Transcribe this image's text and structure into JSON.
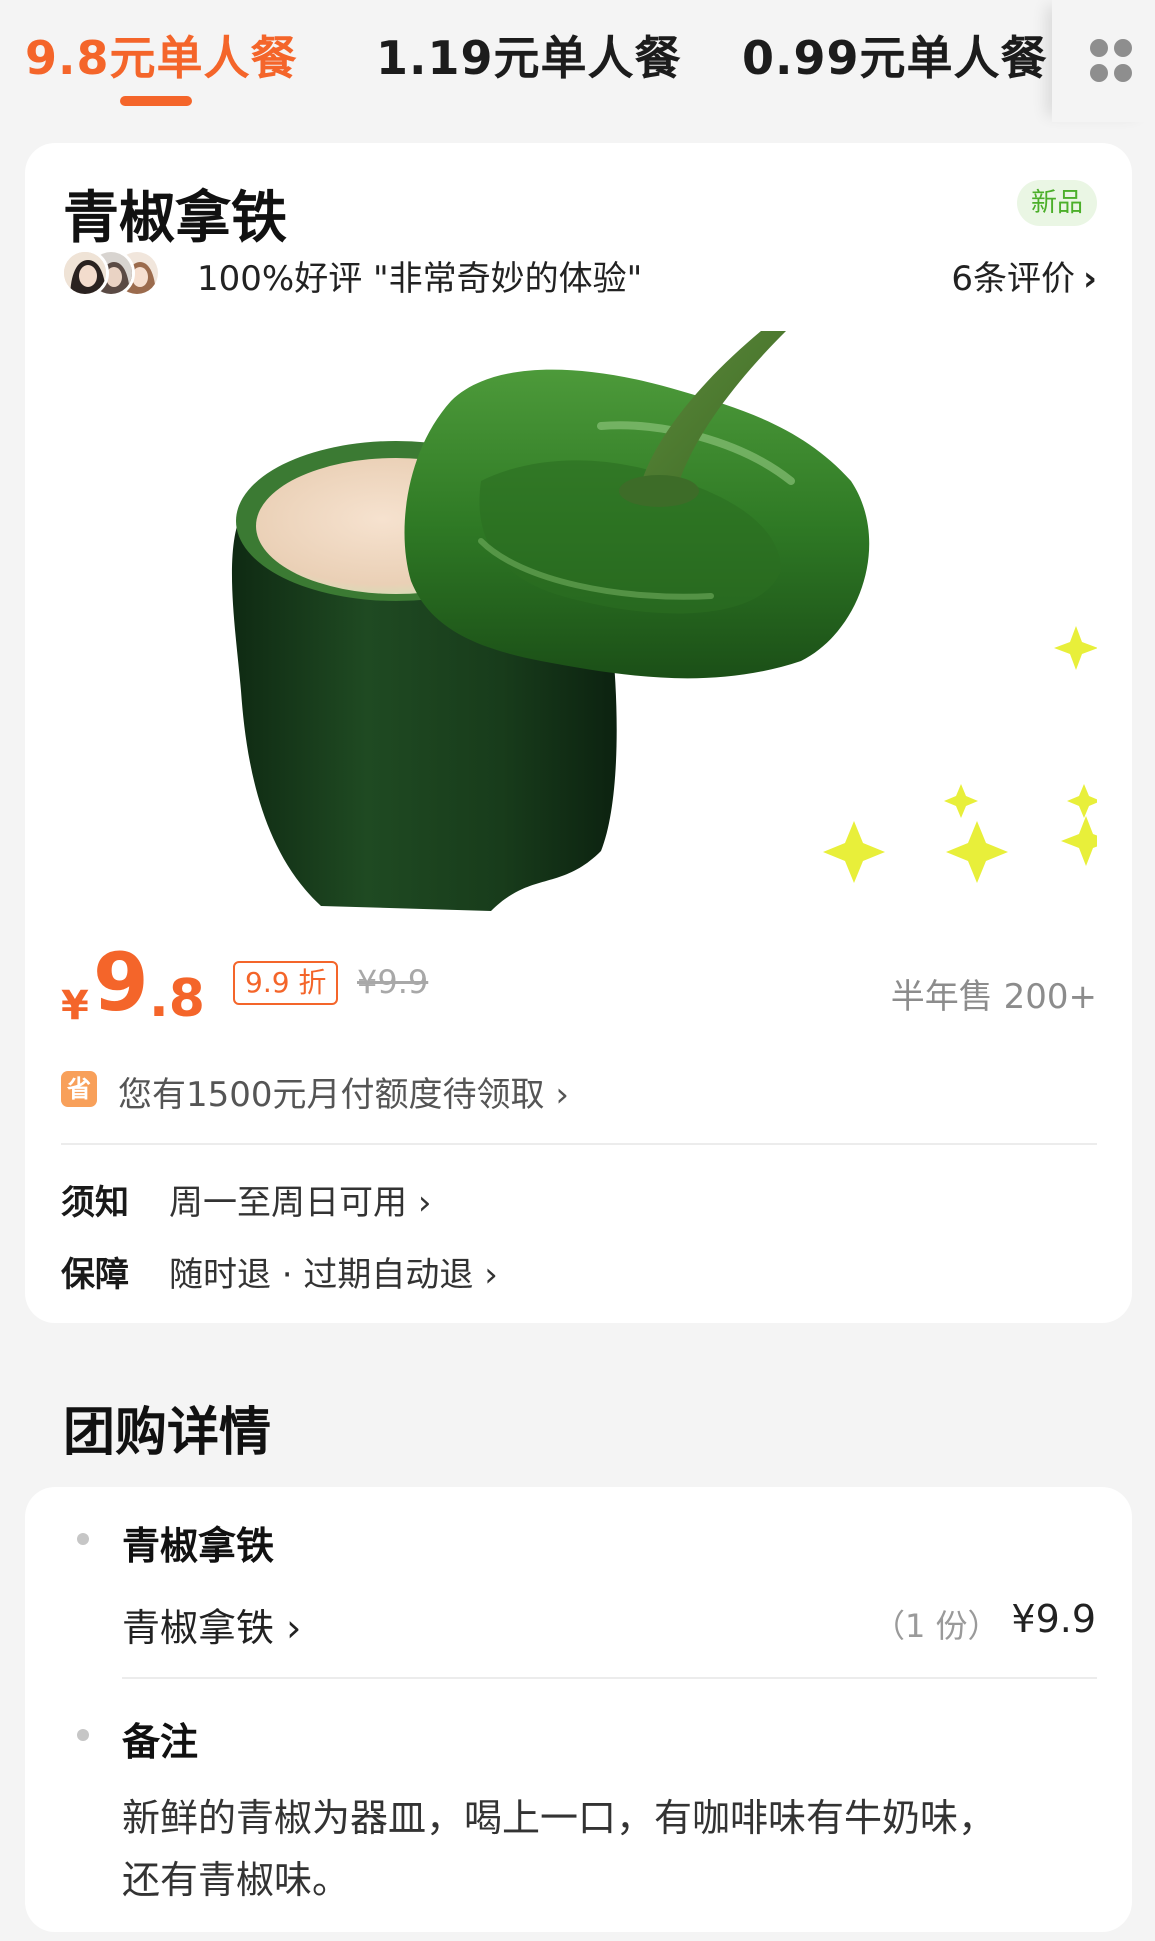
{
  "tabs": [
    {
      "label": "9.8元单人餐",
      "active": true
    },
    {
      "label": "1.19元单人餐",
      "active": false
    },
    {
      "label": "0.99元单人餐",
      "active": false
    }
  ],
  "product": {
    "title": "青椒拿铁",
    "badge": "新品",
    "rating_text": "100%好评  \"非常奇妙的体验\"",
    "review_count": "6条评价",
    "price_currency": "¥",
    "price_int": "9",
    "price_dec": ".8",
    "discount": "9.9 折",
    "original_price": "¥9.9",
    "sold": "半年售 200+",
    "promo_icon": "省",
    "promo_text": "您有1500元月付额度待领取",
    "notice_label": "须知",
    "notice_value": "周一至周日可用",
    "guarantee_label": "保障",
    "guarantee_value": "随时退 · 过期自动退"
  },
  "details": {
    "section_title": "团购详情",
    "group_heading": "青椒拿铁",
    "item_name": "青椒拿铁",
    "item_qty": "（1 份）",
    "item_price": "¥9.9",
    "note_heading": "备注",
    "note_text": "新鲜的青椒为器皿，喝上一口，有咖啡味有牛奶味，还有青椒味。"
  },
  "colors": {
    "accent": "#f4652a",
    "badge_green": "#4caf2a",
    "background": "#f4f4f4"
  },
  "icons": {
    "more": "grid-dots-icon",
    "chevron": "chevron-right-icon",
    "promo": "save-badge-icon"
  }
}
